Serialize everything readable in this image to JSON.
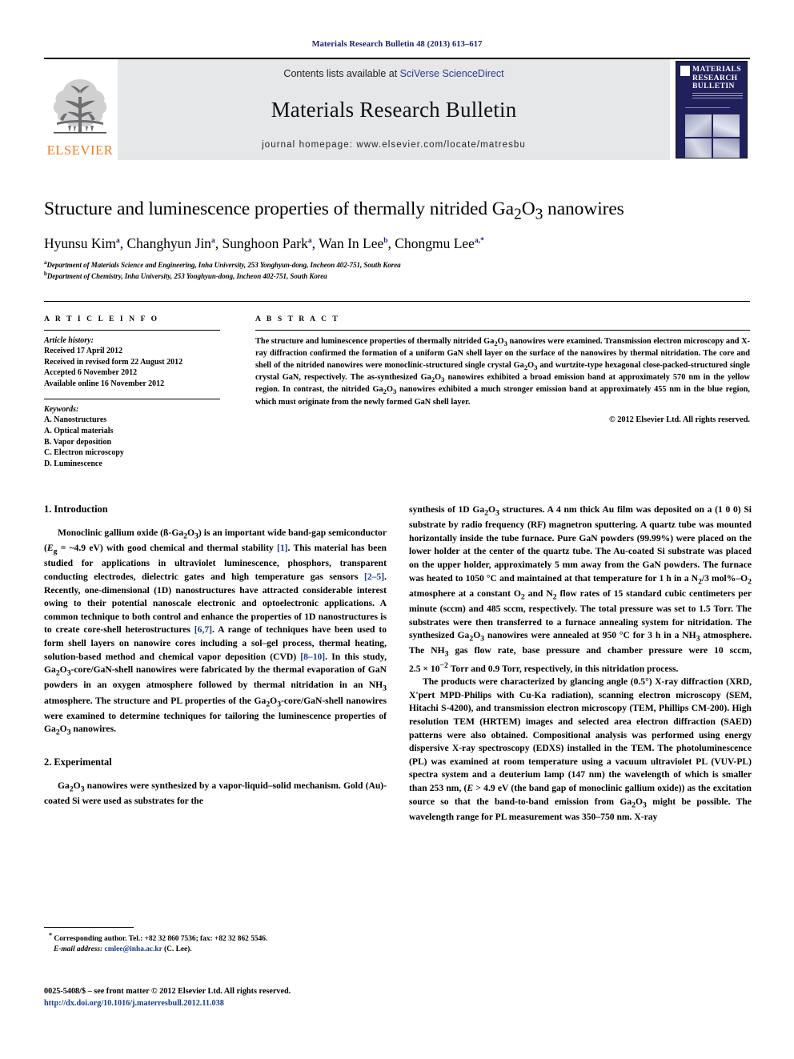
{
  "running_head": "Materials Research Bulletin 48 (2013) 613–617",
  "masthead": {
    "publisher_wordmark": "ELSEVIER",
    "contents_prefix": "Contents lists available at ",
    "contents_link": "SciVerse ScienceDirect",
    "journal_name": "Materials Research Bulletin",
    "homepage_line": "journal homepage: www.elsevier.com/locate/matresbu",
    "cover_title_lines": [
      "MATERIALS",
      "RESEARCH",
      "BULLETIN"
    ]
  },
  "article": {
    "title_pre": "Structure and luminescence properties of thermally nitrided Ga",
    "title_sub1": "2",
    "title_mid": "O",
    "title_sub2": "3",
    "title_post": " nanowires",
    "title_plain": "Structure and luminescence properties of thermally nitrided Ga2O3 nanowires",
    "authors": [
      {
        "name": "Hyunsu Kim",
        "mark": "a"
      },
      {
        "name": "Changhyun Jin",
        "mark": "a"
      },
      {
        "name": "Sunghoon Park",
        "mark": "a"
      },
      {
        "name": "Wan In Lee",
        "mark": "b"
      },
      {
        "name": "Chongmu Lee",
        "mark": "a,*"
      }
    ],
    "affiliations": [
      {
        "mark": "a",
        "text": "Department of Materials Science and Engineering, Inha University, 253 Yonghyun-dong, Incheon 402-751, South Korea"
      },
      {
        "mark": "b",
        "text": "Department of Chemistry, Inha University, 253 Yonghyun-dong, Incheon 402-751, South Korea"
      }
    ]
  },
  "article_info": {
    "heading": "A R T I C L E   I N F O",
    "history_label": "Article history:",
    "history": [
      "Received 17 April 2012",
      "Received in revised form 22 August 2012",
      "Accepted 6 November 2012",
      "Available online 16 November 2012"
    ],
    "keywords_label": "Keywords:",
    "keywords": [
      "A. Nanostructures",
      "A. Optical materials",
      "B. Vapor deposition",
      "C. Electron microscopy",
      "D. Luminescence"
    ]
  },
  "abstract": {
    "heading": "A B S T R A C T",
    "body": "The structure and luminescence properties of thermally nitrided Ga2O3 nanowires were examined. Transmission electron microscopy and X-ray diffraction confirmed the formation of a uniform GaN shell layer on the surface of the nanowires by thermal nitridation. The core and shell of the nitrided nanowires were monoclinic-structured single crystal Ga2O3 and wurtzite-type hexagonal close-packed-structured single crystal GaN, respectively. The as-synthesized Ga2O3 nanowires exhibited a broad emission band at approximately 570 nm in the yellow region. In contrast, the nitrided Ga2O3 nanowires exhibited a much stronger emission band at approximately 455 nm in the blue region, which must originate from the newly formed GaN shell layer.",
    "copyright": "© 2012 Elsevier Ltd. All rights reserved."
  },
  "sections": {
    "introduction_heading": "1. Introduction",
    "experimental_heading": "2. Experimental",
    "intro_para": "Monoclinic gallium oxide (ß-Ga2O3) is an important wide band-gap semiconductor (Eg = ~4.9 eV) with good chemical and thermal stability [1]. This material has been studied for applications in ultraviolet luminescence, phosphors, transparent conducting electrodes, dielectric gates and high temperature gas sensors [2–5]. Recently, one-dimensional (1D) nanostructures have attracted considerable interest owing to their potential nanoscale electronic and optoelectronic applications. A common technique to both control and enhance the properties of 1D nanostructures is to create core-shell heterostructures [6,7]. A range of techniques have been used to form shell layers on nanowire cores including a sol–gel process, thermal heating, solution-based method and chemical vapor deposition (CVD) [8–10]. In this study, Ga2O3-core/GaN-shell nanowires were fabricated by the thermal evaporation of GaN powders in an oxygen atmosphere followed by thermal nitridation in an NH3 atmosphere. The structure and PL properties of the Ga2O3-core/GaN-shell nanowires were examined to determine techniques for tailoring the luminescence properties of Ga2O3 nanowires.",
    "exp_para_left": "Ga2O3 nanowires were synthesized by a vapor-liquid–solid mechanism. Gold (Au)-coated Si were used as substrates for the",
    "exp_para_right_1": "synthesis of 1D Ga2O3 structures. A 4 nm thick Au film was deposited on a (1 0 0) Si substrate by radio frequency (RF) magnetron sputtering. A quartz tube was mounted horizontally inside the tube furnace. Pure GaN powders (99.99%) were placed on the lower holder at the center of the quartz tube. The Au-coated Si substrate was placed on the upper holder, approximately 5 mm away from the GaN powders. The furnace was heated to 1050 °C and maintained at that temperature for 1 h in a N2/3 mol%–O2 atmosphere at a constant O2 and N2 flow rates of 15 standard cubic centimeters per minute (sccm) and 485 sccm, respectively. The total pressure was set to 1.5 Torr. The substrates were then transferred to a furnace annealing system for nitridation. The synthesized Ga2O3 nanowires were annealed at 950 °C for 3 h in a NH3 atmosphere. The NH3 gas flow rate, base pressure and chamber pressure were 10 sccm, 2.5 × 10−2 Torr and 0.9 Torr, respectively, in this nitridation process.",
    "exp_para_right_2": "The products were characterized by glancing angle (0.5°) X-ray diffraction (XRD, X'pert MPD-Philips with Cu-Ka radiation), scanning electron microscopy (SEM, Hitachi S-4200), and transmission electron microscopy (TEM, Phillips CM-200). High resolution TEM (HRTEM) images and selected area electron diffraction (SAED) patterns were also obtained. Compositional analysis was performed using energy dispersive X-ray spectroscopy (EDXS) installed in the TEM. The photoluminescence (PL) was examined at room temperature using a vacuum ultraviolet PL (VUV-PL) spectra system and a deuterium lamp (147 nm) the wavelength of which is smaller than 253 nm, (E > 4.9 eV (the band gap of monoclinic gallium oxide)) as the excitation source so that the band-to-band emission from Ga2O3 might be possible. The wavelength range for PL measurement was 350–750 nm. X-ray"
  },
  "footnotes": {
    "corresponding": "Corresponding author. Tel.: +82 32 860 7536; fax: +82 32 862 5546.",
    "email_label": "E-mail address:",
    "email": "cmlee@inha.ac.kr",
    "email_suffix": " (C. Lee)."
  },
  "imprint": {
    "line1": "0025-5408/$ – see front matter © 2012 Elsevier Ltd. All rights reserved.",
    "doi": "http://dx.doi.org/10.1016/j.materresbull.2012.11.038"
  },
  "colors": {
    "link_blue": "#1b3a8c",
    "sciencedirect_blue": "#2b3c8c",
    "elsevier_orange": "#f07c22",
    "cover_navy": "#20205c",
    "band_grey": "#e6e7e8",
    "running_head_navy": "#1b1b6e"
  }
}
